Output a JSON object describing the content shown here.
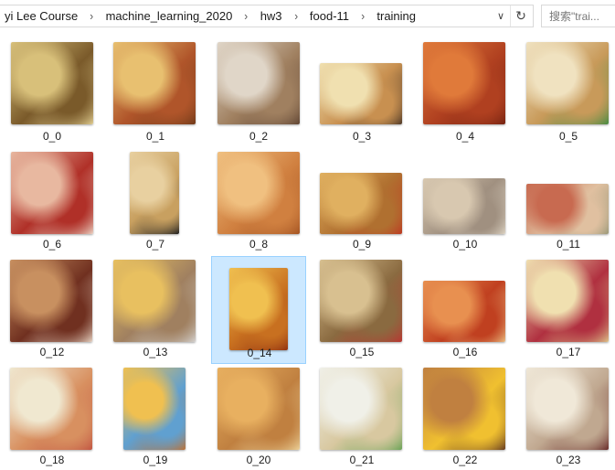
{
  "address_bar": {
    "breadcrumbs": [
      "yi Lee Course",
      "machine_learning_2020",
      "hw3",
      "food-11",
      "training"
    ],
    "separator": "›",
    "dropdown_glyph": "∨",
    "refresh_glyph": "↻"
  },
  "search": {
    "placeholder": "搜索\"trai..."
  },
  "files": [
    {
      "name": "0_0",
      "colors": [
        "#d8c07a",
        "#7a5a2a",
        "#e9d79a"
      ]
    },
    {
      "name": "0_1",
      "colors": [
        "#e8c070",
        "#b0552a",
        "#6b3818"
      ]
    },
    {
      "name": "0_2",
      "colors": [
        "#e0d6c8",
        "#a08060",
        "#5a4030"
      ]
    },
    {
      "name": "0_3",
      "colors": [
        "#f0e0b0",
        "#c89050",
        "#3a2a20"
      ]
    },
    {
      "name": "0_4",
      "colors": [
        "#e07a3a",
        "#b04020",
        "#702010"
      ]
    },
    {
      "name": "0_5",
      "colors": [
        "#f0e2c0",
        "#c89a5a",
        "#3a8a40"
      ]
    },
    {
      "name": "0_6",
      "colors": [
        "#e8b8a0",
        "#b03028",
        "#f0e0d0"
      ]
    },
    {
      "name": "0_7",
      "colors": [
        "#e8d0a0",
        "#c8a060",
        "#202020"
      ]
    },
    {
      "name": "0_8",
      "colors": [
        "#f0c080",
        "#d08040",
        "#a05020"
      ]
    },
    {
      "name": "0_9",
      "colors": [
        "#e0b060",
        "#b07030",
        "#c03020"
      ]
    },
    {
      "name": "0_10",
      "colors": [
        "#d8c8b0",
        "#a09080",
        "#e8e0d0"
      ]
    },
    {
      "name": "0_11",
      "colors": [
        "#c86a50",
        "#e0c0a0",
        "#8a9070"
      ]
    },
    {
      "name": "0_12",
      "colors": [
        "#c89060",
        "#703020",
        "#f0e0d0"
      ]
    },
    {
      "name": "0_13",
      "colors": [
        "#e8c060",
        "#a08060",
        "#d8d8d8"
      ]
    },
    {
      "name": "0_14",
      "colors": [
        "#f0c050",
        "#c87020",
        "#903010"
      ]
    },
    {
      "name": "0_15",
      "colors": [
        "#d8c090",
        "#8a6a40",
        "#c03030"
      ]
    },
    {
      "name": "0_16",
      "colors": [
        "#e89050",
        "#c04020",
        "#f0d090"
      ]
    },
    {
      "name": "0_17",
      "colors": [
        "#f0e0b0",
        "#b03040",
        "#e0d090"
      ]
    },
    {
      "name": "0_18",
      "colors": [
        "#f0e8d0",
        "#d89060",
        "#c05040"
      ]
    },
    {
      "name": "0_19",
      "colors": [
        "#f0c050",
        "#60a0d0",
        "#c07030"
      ]
    },
    {
      "name": "0_20",
      "colors": [
        "#e8b060",
        "#c08040",
        "#f0d8a0"
      ]
    },
    {
      "name": "0_21",
      "colors": [
        "#f0f0e8",
        "#d8c8a0",
        "#60a050"
      ]
    },
    {
      "name": "0_22",
      "colors": [
        "#c08040",
        "#f0c030",
        "#5a3020"
      ]
    },
    {
      "name": "0_23",
      "colors": [
        "#f0e8d8",
        "#c0a890",
        "#602020"
      ]
    }
  ],
  "selected_file": "0_14"
}
